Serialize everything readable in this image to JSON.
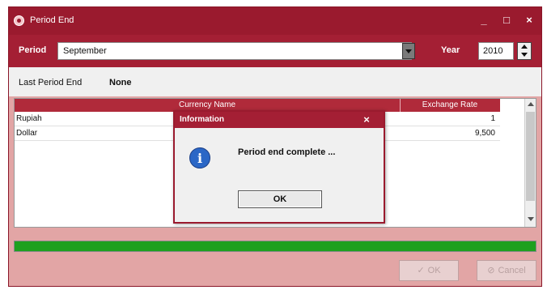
{
  "window": {
    "title": "Period End",
    "controls": {
      "minimize": "_",
      "maximize": "□",
      "close": "×"
    }
  },
  "period": {
    "label": "Period",
    "value": "September",
    "year_label": "Year",
    "year_value": "2010"
  },
  "info": {
    "last_period_label": "Last Period End",
    "last_period_value": "None"
  },
  "grid": {
    "columns": [
      "Currency Name",
      "Exchange Rate"
    ],
    "rows": [
      {
        "name": "Rupiah",
        "rate": "1"
      },
      {
        "name": "Dollar",
        "rate": "9,500"
      }
    ]
  },
  "progress": {
    "percent": 100,
    "color": "#1ea01e"
  },
  "buttons": {
    "ok": "OK",
    "cancel": "Cancel"
  },
  "dialog": {
    "title": "Information",
    "close": "×",
    "icon": "info-icon",
    "icon_glyph": "i",
    "message": "Period end complete ...",
    "ok": "OK"
  },
  "colors": {
    "title_bar": "#9a1a2e",
    "accent": "#a41f34",
    "window_bg": "#e2a5a5"
  }
}
